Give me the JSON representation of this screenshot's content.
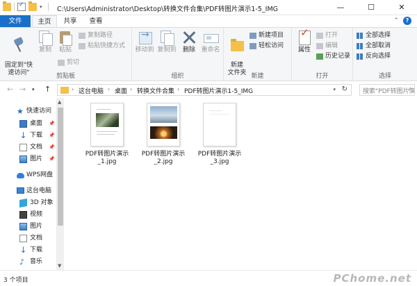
{
  "window": {
    "title": "C:\\Users\\Administrator\\Desktop\\转换文件合集\\PDF转图片演示1-5_IMG",
    "minimize": "—",
    "maximize": "☐",
    "close": "✕"
  },
  "tabs": {
    "file": "文件",
    "home": "主页",
    "share": "共享",
    "view": "查看"
  },
  "ribbon": {
    "clipboard": {
      "label": "剪贴板",
      "pin": "固定到\"快\n速访问\"",
      "copy": "复制",
      "paste": "粘贴",
      "copy_path": "复制路径",
      "paste_shortcut": "粘贴快捷方式",
      "cut": "剪切"
    },
    "organize": {
      "label": "组织",
      "move_to": "移动到",
      "copy_to": "复制到",
      "delete": "删除",
      "rename": "重命名"
    },
    "new": {
      "label": "新建",
      "new_folder": "新建\n文件夹",
      "new_item": "新建项目",
      "easy_access": "轻松访问"
    },
    "open": {
      "label": "打开",
      "properties": "属性",
      "open": "打开",
      "edit": "编辑",
      "history": "历史记录"
    },
    "select": {
      "label": "选择",
      "select_all": "全部选择",
      "select_none": "全部取消",
      "invert": "反向选择"
    }
  },
  "address": {
    "breadcrumbs": [
      "这台电脑",
      "桌面",
      "转换文件合集",
      "PDF转图片演示1-5_IMG"
    ],
    "search_placeholder": "搜索\"PDF转图片演示1-5_IMG\""
  },
  "nav": {
    "quick_access": "快速访问",
    "quick_items": [
      "桌面",
      "下载",
      "文档",
      "图片"
    ],
    "wps": "WPS网盘",
    "this_pc": "这台电脑",
    "pc_items": [
      "3D 对象",
      "视频",
      "图片",
      "文档",
      "下载",
      "音乐"
    ]
  },
  "files": [
    {
      "name": "PDF转图片演示\n_1.jpg"
    },
    {
      "name": "PDF转图片演示\n_2.jpg"
    },
    {
      "name": "PDF转图片演示\n_3.jpg"
    }
  ],
  "status": {
    "count": "3 个项目",
    "watermark": "PChome.net"
  }
}
